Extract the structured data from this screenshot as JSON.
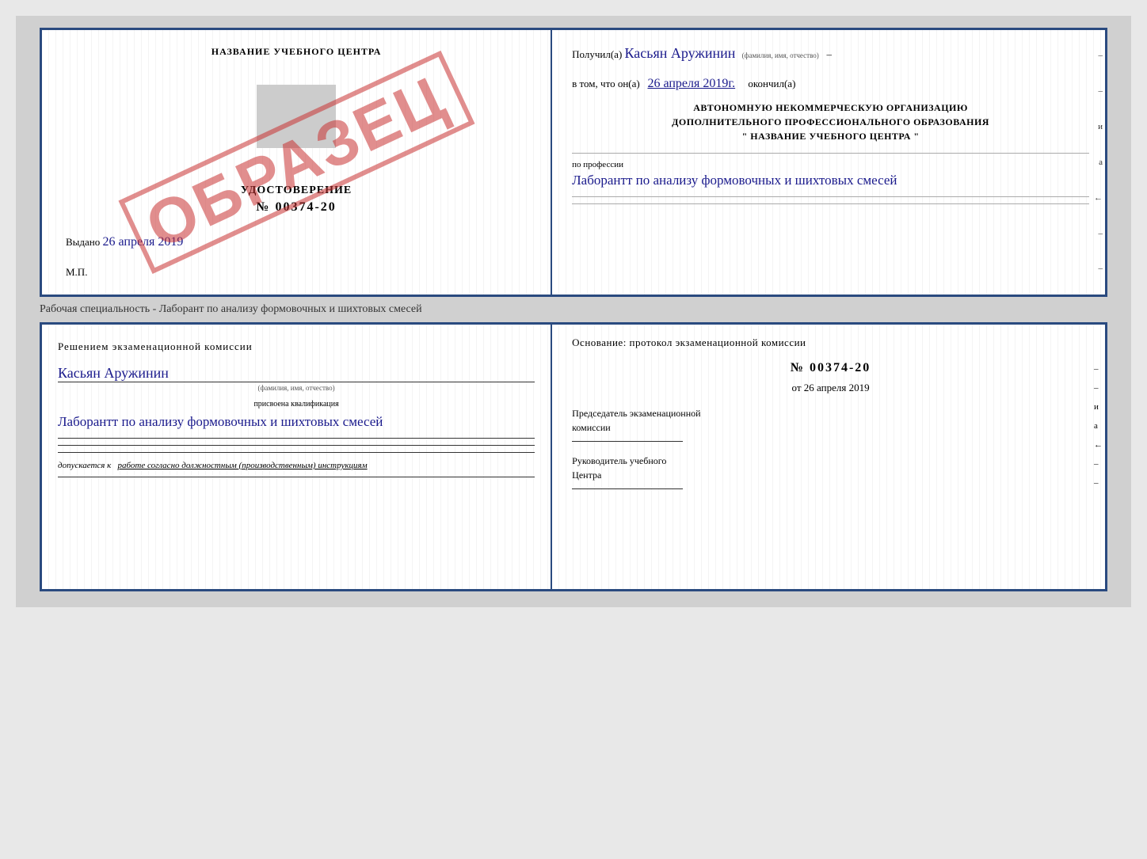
{
  "page": {
    "background": "#d0d0d0"
  },
  "top_cert": {
    "left": {
      "title": "НАЗВАНИЕ УЧЕБНОГО ЦЕНТРА",
      "stamp_text": "ОБРАЗЕЦ",
      "udostoverenie_label": "УДОСТОВЕРЕНИЕ",
      "cert_number": "№ 00374-20",
      "vydano_label": "Выдано",
      "vydano_date": "26 апреля 2019",
      "mp_label": "М.П."
    },
    "right": {
      "poluchil_label": "Получил(а)",
      "fio_handwritten": "Касьян Аружинин",
      "fio_sub": "(фамилия, имя, отчество)",
      "vtom_label": "в том, что он(а)",
      "vtom_date": "26 апреля 2019г.",
      "okonchil_label": "окончил(а)",
      "org_line1": "АВТОНОМНУЮ НЕКОММЕРЧЕСКУЮ ОРГАНИЗАЦИЮ",
      "org_line2": "ДОПОЛНИТЕЛЬНОГО ПРОФЕССИОНАЛЬНОГО ОБРАЗОВАНИЯ",
      "org_line3": "\"  НАЗВАНИЕ УЧЕБНОГО ЦЕНТРА  \"",
      "professii_label": "по профессии",
      "professii_text": "Лаборантт по анализу формовочных и шихтовых смесей",
      "right_marks": [
        "–",
        "–",
        "и",
        "а",
        "←",
        "–",
        "–"
      ]
    }
  },
  "spacer": {
    "label": "Рабочая специальность - Лаборант по анализу формовочных и шихтовых смесей"
  },
  "bottom_cert": {
    "left": {
      "resheniem_title": "Решением  экзаменационной  комиссии",
      "fio_handwritten": "Касьян  Аружинин",
      "fio_sub": "(фамилия, имя, отчество)",
      "prisvoena_label": "присвоена квалификация",
      "kvali_text": "Лаборантт по анализу формовочных и шихтовых смесей",
      "dopuskaetsya_label": "допускается к",
      "dopusk_text": "работе согласно должностным (производственным) инструкциям"
    },
    "right": {
      "osnovaniye_title": "Основание: протокол экзаменационной  комиссии",
      "protocol_number": "№  00374-20",
      "ot_label": "от",
      "ot_date": "26 апреля 2019",
      "predsedatel_line1": "Председатель экзаменационной",
      "predsedatel_line2": "комиссии",
      "rukovoditel_line1": "Руководитель учебного",
      "rukovoditel_line2": "Центра",
      "right_marks": [
        "–",
        "–",
        "и",
        "а",
        "←",
        "–",
        "–"
      ]
    }
  }
}
